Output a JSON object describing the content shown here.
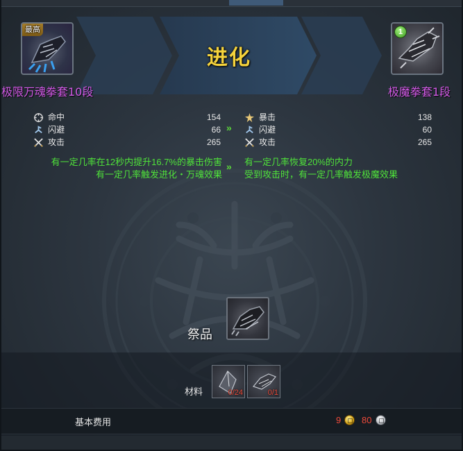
{
  "window": {
    "title": "进化"
  },
  "source_item": {
    "badge": "最高",
    "name": "极限万魂拳套10段",
    "icon": "claw-gauntlet-icon"
  },
  "target_item": {
    "badge": "1",
    "name": "极魔拳套1段",
    "icon": "dark-gauntlet-icon"
  },
  "source_stats": [
    {
      "icon": "crosshair-icon",
      "label": "命中",
      "value": "154"
    },
    {
      "icon": "dodge-icon",
      "label": "闪避",
      "value": "66"
    },
    {
      "icon": "crossed-swords-icon",
      "label": "攻击",
      "value": "265"
    }
  ],
  "target_stats": [
    {
      "icon": "burst-icon",
      "label": "暴击",
      "value": "138"
    },
    {
      "icon": "dodge-icon",
      "label": "闪避",
      "value": "60"
    },
    {
      "icon": "crossed-swords-icon",
      "label": "攻击",
      "value": "265"
    }
  ],
  "source_effects": [
    "有一定几率在12秒内提升16.7%的暴击伤害",
    "有一定几率触发进化・万魂效果"
  ],
  "target_effects": [
    "有一定几率恢复20%的内力",
    "受到攻击时，有一定几率触发极魔效果"
  ],
  "arrows": "»",
  "offering": {
    "label": "祭品",
    "icon": "gauntlet-offering-icon"
  },
  "materials": {
    "label": "材料",
    "slots": [
      {
        "icon": "crystal-shard-icon",
        "count": "0/24"
      },
      {
        "icon": "claw-fragment-icon",
        "count": "0/1"
      }
    ]
  },
  "cost": {
    "label": "基本费用",
    "gold": "9",
    "silver": "80"
  },
  "colors": {
    "title": "#f4d23c",
    "item_name": "#d25ae6",
    "effect_text": "#4fe23a",
    "insufficient": "#ee4a3a"
  }
}
